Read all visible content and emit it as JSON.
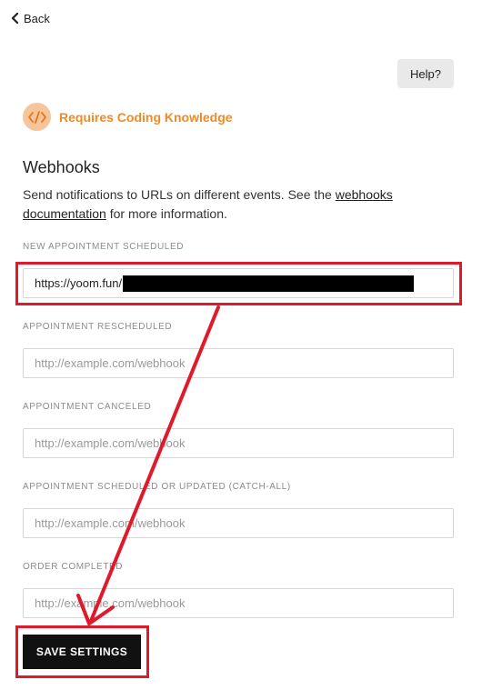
{
  "header": {
    "back_label": "Back",
    "help_label": "Help?"
  },
  "badge": {
    "text": "Requires Coding Knowledge",
    "icon": "code-icon",
    "color": "#f08a24"
  },
  "webhooks": {
    "title": "Webhooks",
    "desc_before": "Send notifications to URLs on different events. See the ",
    "desc_link_1": "webhooks",
    "desc_link_2": "documentation",
    "desc_after": " for more information."
  },
  "fields": [
    {
      "label": "NEW APPOINTMENT SCHEDULED",
      "value": "https://yoom.fun/",
      "placeholder": "http://example.com/webhook"
    },
    {
      "label": "APPOINTMENT RESCHEDULED",
      "value": "",
      "placeholder": "http://example.com/webhook"
    },
    {
      "label": "APPOINTMENT CANCELED",
      "value": "",
      "placeholder": "http://example.com/webhook"
    },
    {
      "label": "APPOINTMENT SCHEDULED OR UPDATED (CATCH-ALL)",
      "value": "",
      "placeholder": "http://example.com/webhook"
    },
    {
      "label": "ORDER COMPLETED",
      "value": "",
      "placeholder": "http://example.com/webhook"
    }
  ],
  "save_label": "SAVE SETTINGS",
  "annotation_color": "#e0192b"
}
